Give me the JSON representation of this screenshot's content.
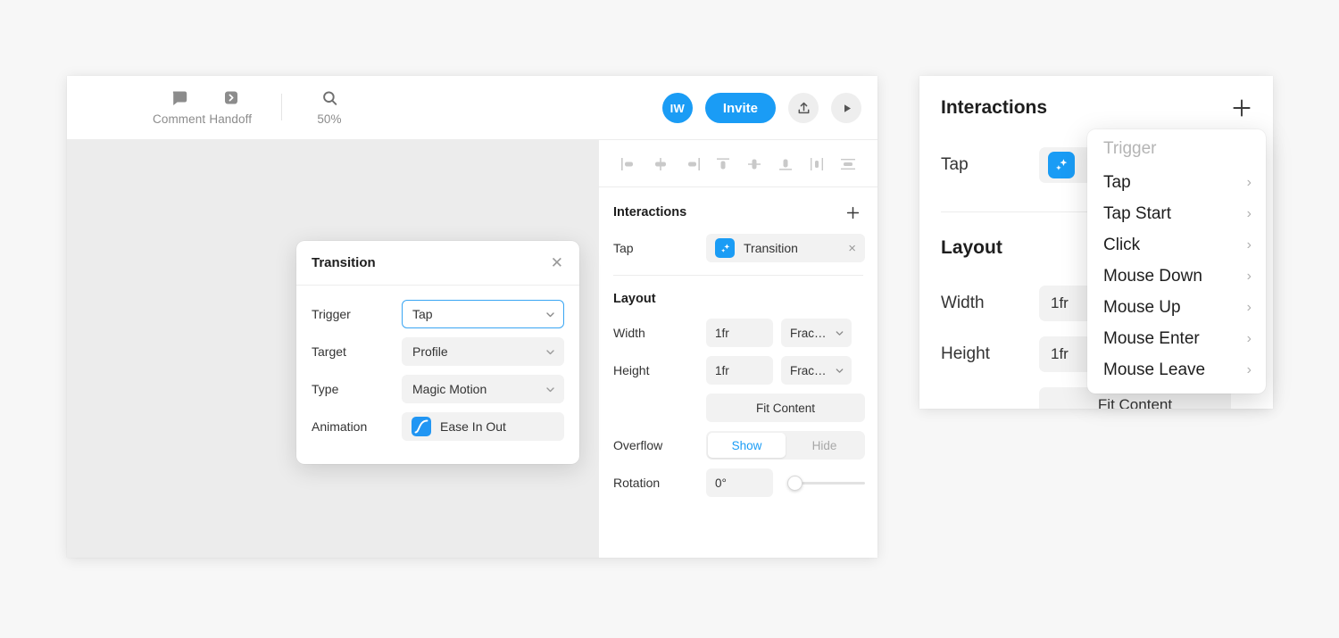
{
  "toolbar": {
    "comment_label": "Comment",
    "comment_icon": "comment-bubble-icon",
    "handoff_label": "Handoff",
    "handoff_icon": "handoff-chevron-icon",
    "zoom_label": "50%",
    "zoom_icon": "search-icon",
    "avatar_initials": "IW",
    "invite_label": "Invite",
    "share_icon": "upload-share-icon",
    "play_icon": "play-icon"
  },
  "inspector": {
    "align_icons": [
      "align-left-icon",
      "align-horizontal-center-icon",
      "align-right-icon",
      "align-top-icon",
      "align-vertical-center-icon",
      "align-bottom-icon",
      "distribute-horizontal-icon",
      "distribute-vertical-icon"
    ],
    "interactions": {
      "title": "Interactions",
      "add_icon": "plus-icon",
      "rows": [
        {
          "trigger": "Tap",
          "action": "Transition",
          "icon": "sparkle-icon",
          "remove": "×"
        }
      ]
    },
    "layout": {
      "title": "Layout",
      "width_label": "Width",
      "width_value": "1fr",
      "width_unit": "Frac…",
      "height_label": "Height",
      "height_value": "1fr",
      "height_unit": "Frac…",
      "fit_content_label": "Fit Content",
      "overflow_label": "Overflow",
      "overflow_show": "Show",
      "overflow_hide": "Hide",
      "overflow_selected": "Show",
      "rotation_label": "Rotation",
      "rotation_value": "0°"
    }
  },
  "transition_popup": {
    "title": "Transition",
    "close_icon": "close-icon",
    "trigger_label": "Trigger",
    "trigger_value": "Tap",
    "target_label": "Target",
    "target_value": "Profile",
    "type_label": "Type",
    "type_value": "Magic Motion",
    "animation_label": "Animation",
    "animation_value": "Ease In Out",
    "animation_icon": "easing-curve-icon"
  },
  "right_panel": {
    "title": "Interactions",
    "add_icon": "plus-icon",
    "row_trigger": "Tap",
    "row_icon": "sparkle-icon",
    "layout_title": "Layout",
    "width_label": "Width",
    "width_value": "1fr",
    "height_label": "Height",
    "height_value": "1fr",
    "fit_content_label": "Fit Content"
  },
  "trigger_menu": {
    "header": "Trigger",
    "items": [
      {
        "label": "Tap",
        "chevron": "chevron-right-icon"
      },
      {
        "label": "Tap Start",
        "chevron": "chevron-right-icon"
      },
      {
        "label": "Click",
        "chevron": "chevron-right-icon"
      },
      {
        "label": "Mouse Down",
        "chevron": "chevron-right-icon"
      },
      {
        "label": "Mouse Up",
        "chevron": "chevron-right-icon"
      },
      {
        "label": "Mouse Enter",
        "chevron": "chevron-right-icon"
      },
      {
        "label": "Mouse Leave",
        "chevron": "chevron-right-icon"
      }
    ]
  },
  "colors": {
    "accent": "#1a9cf5",
    "canvas": "#ececec",
    "page_bg": "#f7f7f7",
    "field_bg": "#f2f2f2"
  }
}
